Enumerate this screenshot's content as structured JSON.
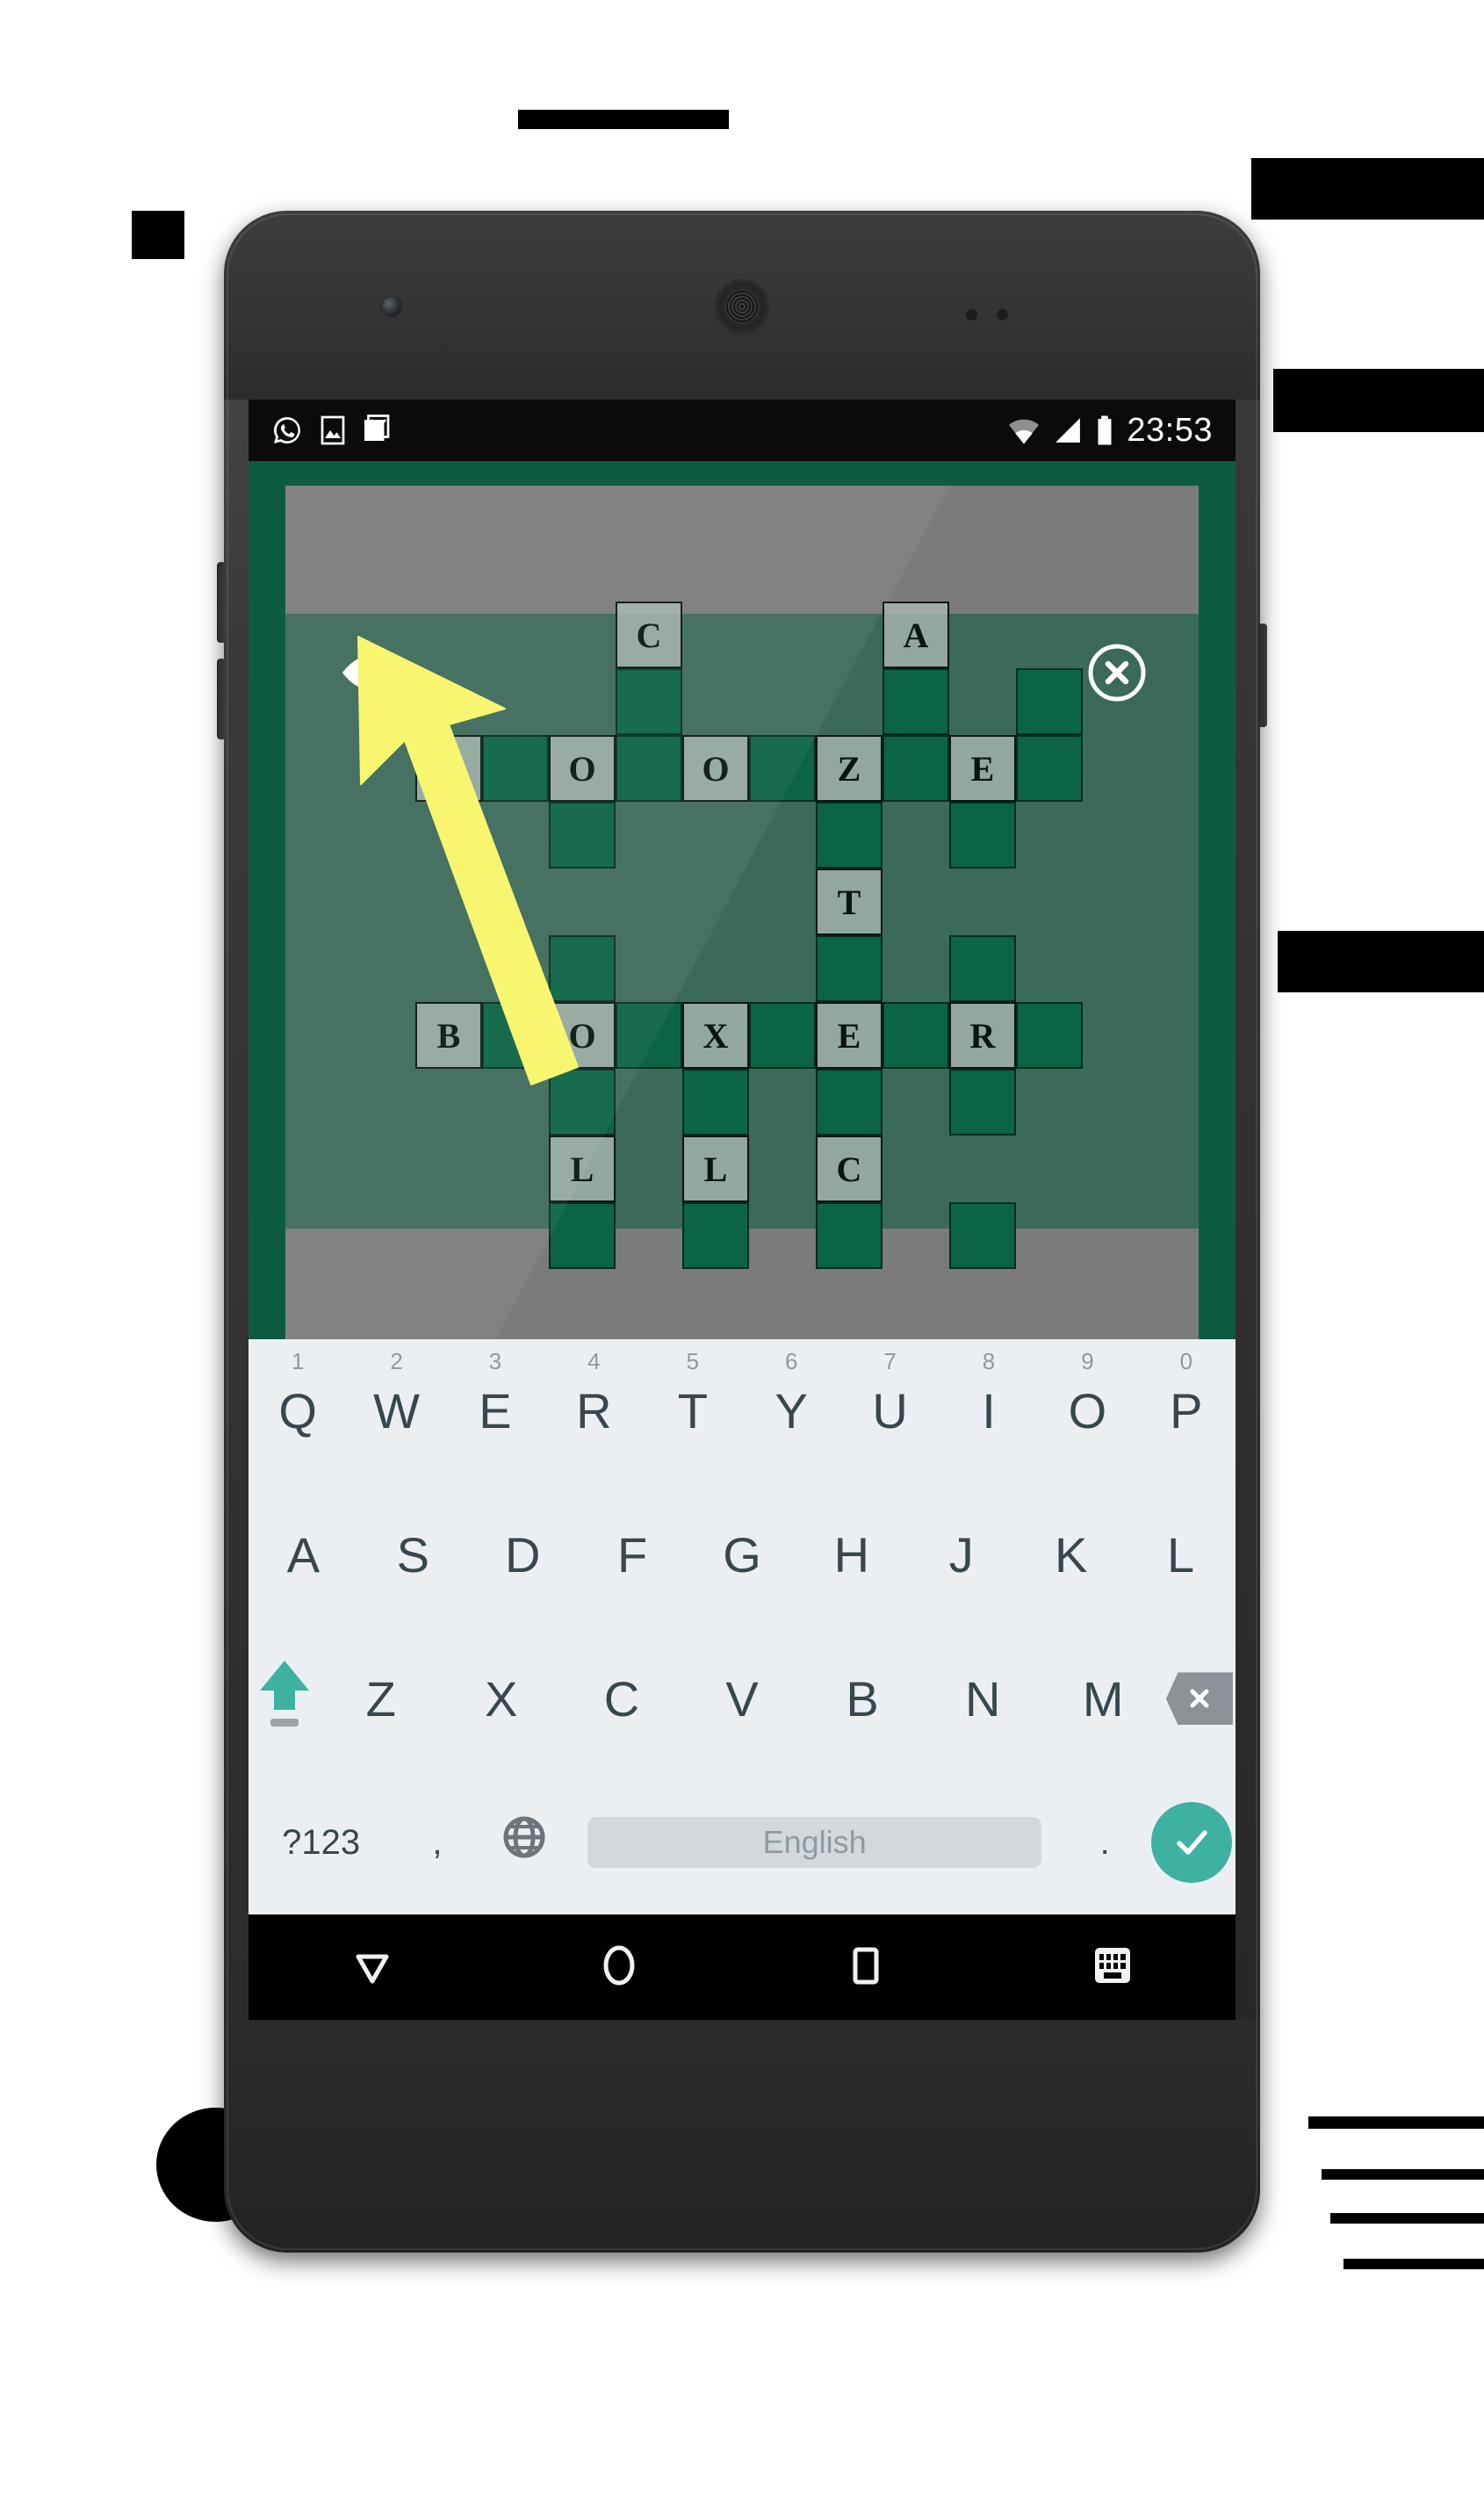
{
  "statusbar": {
    "time": "23:53",
    "icons_left": [
      "whatsapp-icon",
      "gallery-icon",
      "gmail-icon"
    ],
    "icons_right": [
      "wifi-icon",
      "cellular-signal-icon",
      "battery-icon"
    ]
  },
  "game": {
    "reveal_button": "eye-icon",
    "close_button": "close-circle-icon",
    "board_bg": "#7b7b7b",
    "board_active_bg": "rgba(19,94,69,0.62)",
    "block_color": "#0b6444",
    "letter_cell_color": "#aab9b2",
    "arrow_color": "#f6f36e",
    "grid": {
      "columns": 10,
      "rows": 11,
      "cells": [
        [
          "blank",
          "blank",
          "blank",
          "letter:C",
          "blank",
          "blank",
          "blank",
          "letter:A",
          "blank",
          "blank"
        ],
        [
          "blank",
          "blank",
          "blank",
          "block",
          "blank",
          "blank",
          "blank",
          "block",
          "blank",
          "block"
        ],
        [
          "letter:B",
          "block",
          "letter:O",
          "block",
          "letter:O",
          "block",
          "letter:Z",
          "block",
          "letter:E",
          "block"
        ],
        [
          "blank",
          "blank",
          "block",
          "blank",
          "blank",
          "blank",
          "block",
          "blank",
          "block",
          "blank"
        ],
        [
          "blank",
          "blank",
          "blank",
          "blank",
          "blank",
          "blank",
          "letter:T",
          "blank",
          "blank",
          "blank"
        ],
        [
          "blank",
          "blank",
          "block",
          "blank",
          "blank",
          "blank",
          "block",
          "blank",
          "block",
          "blank"
        ],
        [
          "letter:B",
          "block",
          "letter:O",
          "block",
          "letter:X",
          "block",
          "letter:E",
          "block",
          "letter:R",
          "block"
        ],
        [
          "blank",
          "blank",
          "block",
          "blank",
          "block",
          "blank",
          "block",
          "blank",
          "block",
          "blank"
        ],
        [
          "blank",
          "blank",
          "letter:L",
          "blank",
          "letter:L",
          "blank",
          "letter:C",
          "blank",
          "blank",
          "blank"
        ],
        [
          "blank",
          "blank",
          "block",
          "blank",
          "block",
          "blank",
          "block",
          "blank",
          "block",
          "blank"
        ],
        [
          "blank",
          "blank",
          "blank",
          "blank",
          "blank",
          "blank",
          "blank",
          "blank",
          "blank",
          "blank"
        ]
      ],
      "across_words": [
        "BOOZE",
        "BOXER"
      ],
      "visible_letters": [
        "C",
        "A",
        "B",
        "O",
        "O",
        "Z",
        "E",
        "T",
        "B",
        "O",
        "X",
        "E",
        "R",
        "L",
        "L",
        "C"
      ]
    }
  },
  "keyboard": {
    "row1": [
      {
        "label": "Q",
        "hint": "1"
      },
      {
        "label": "W",
        "hint": "2"
      },
      {
        "label": "E",
        "hint": "3"
      },
      {
        "label": "R",
        "hint": "4"
      },
      {
        "label": "T",
        "hint": "5"
      },
      {
        "label": "Y",
        "hint": "6"
      },
      {
        "label": "U",
        "hint": "7"
      },
      {
        "label": "I",
        "hint": "8"
      },
      {
        "label": "O",
        "hint": "9"
      },
      {
        "label": "P",
        "hint": "0"
      }
    ],
    "row2": [
      "A",
      "S",
      "D",
      "F",
      "G",
      "H",
      "J",
      "K",
      "L"
    ],
    "row3": [
      "Z",
      "X",
      "C",
      "V",
      "B",
      "N",
      "M"
    ],
    "shift_key": "shift-icon",
    "backspace_key": "backspace-icon",
    "row4": {
      "symbols": "?123",
      "comma": ",",
      "globe": "globe-icon",
      "space_label": "English",
      "period": ".",
      "enter": "check-icon"
    },
    "accent_color": "#3eb1a0",
    "key_text_color": "#37474f",
    "bg_color": "#eceff1"
  },
  "navbar": {
    "items": [
      "back-icon",
      "home-icon",
      "recents-icon",
      "keyboard-switch-icon"
    ]
  }
}
